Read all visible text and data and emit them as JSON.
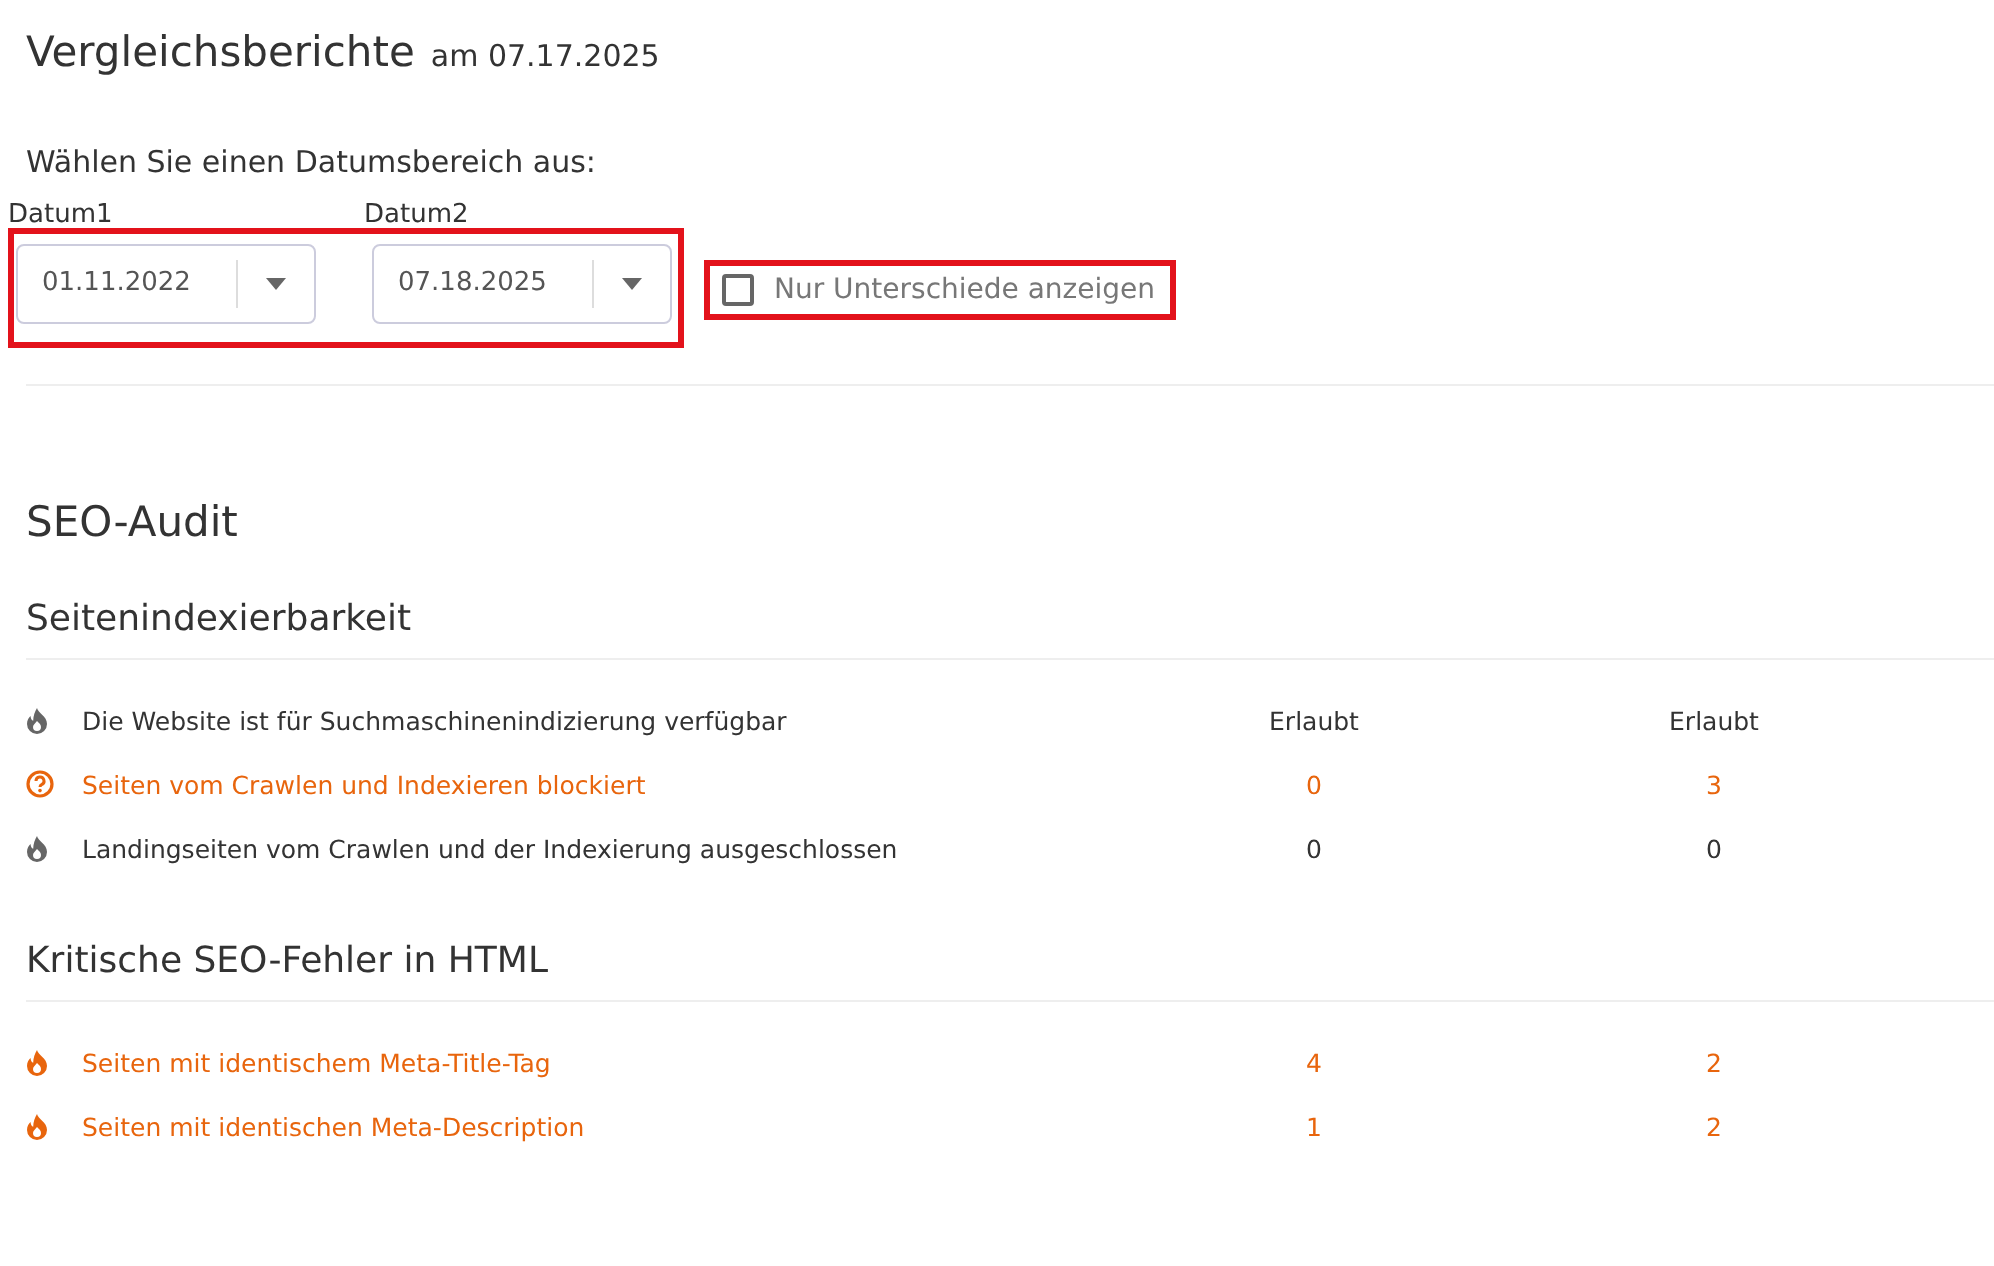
{
  "header": {
    "title": "Vergleichsberichte",
    "date": "am 07.17.2025"
  },
  "range_label": "Wählen Sie einen Datumsbereich aus:",
  "date_pickers": {
    "highlighted": true,
    "fields": [
      {
        "label": "Datum1",
        "value": "01.11.2022"
      },
      {
        "label": "Datum2",
        "value": "07.18.2025"
      }
    ]
  },
  "differences_only": {
    "label": "Nur Unterschiede anzeigen",
    "checked": false,
    "highlighted": true
  },
  "audit_title": "SEO-Audit",
  "sections": [
    {
      "title": "Seitenindexierbarkeit",
      "rows": [
        {
          "kind": "neutral",
          "label": "Die Website ist für Suchmaschinenindizierung verfügbar",
          "value_1": "Erlaubt",
          "value_2": "Erlaubt"
        },
        {
          "kind": "warning",
          "label": "Seiten vom Crawlen und Indexieren blockiert",
          "value_1": "0",
          "value_2": "3"
        },
        {
          "kind": "neutral",
          "label": "Landingseiten vom Crawlen und der Indexierung ausgeschlossen",
          "value_1": "0",
          "value_2": "0"
        }
      ]
    },
    {
      "title": "Kritische SEO-Fehler in HTML",
      "rows": [
        {
          "kind": "error",
          "label": "Seiten mit identischem Meta-Title-Tag",
          "value_1": "4",
          "value_2": "2"
        },
        {
          "kind": "error",
          "label": "Seiten mit identischen Meta-Description",
          "value_1": "1",
          "value_2": "2"
        }
      ]
    }
  ]
}
